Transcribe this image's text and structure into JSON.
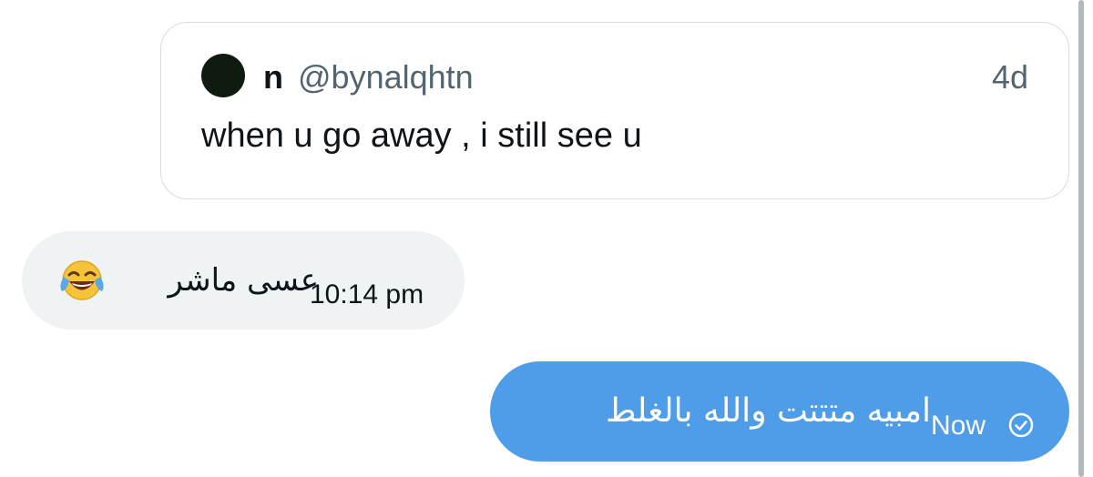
{
  "quoted_tweet": {
    "display_name": "n",
    "handle": "@bynalqhtn",
    "age": "4d",
    "text": "when u go away , i still see u"
  },
  "messages": [
    {
      "direction": "incoming",
      "text": "عسى ماشر",
      "emoji": "face-with-tears-of-joy-icon",
      "time": "10:14 pm"
    },
    {
      "direction": "outgoing",
      "text": "امبيه متتتت والله بالغلط",
      "time": "Now",
      "status_icon": "check-circle-icon"
    }
  ],
  "colors": {
    "incoming_bubble": "#eff3f4",
    "outgoing_bubble": "#4f9de8",
    "card_border": "#d7dde2",
    "muted_text": "#536471",
    "avatar": "#0f1a10"
  }
}
